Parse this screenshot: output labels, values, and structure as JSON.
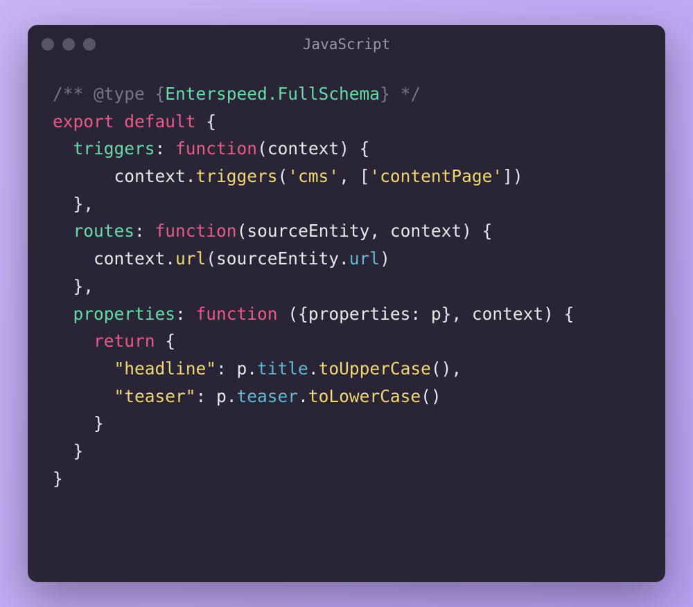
{
  "window": {
    "title": "JavaScript"
  },
  "code": {
    "tokens": [
      [
        {
          "t": "/** ",
          "c": "c-comment"
        },
        {
          "t": "@type",
          "c": "c-comment"
        },
        {
          "t": " {",
          "c": "c-comment"
        },
        {
          "t": "Enterspeed.FullSchema",
          "c": "c-type"
        },
        {
          "t": "} */",
          "c": "c-comment"
        }
      ],
      [
        {
          "t": "export",
          "c": "c-keyword"
        },
        {
          "t": " ",
          "c": "c-default"
        },
        {
          "t": "default",
          "c": "c-keyword"
        },
        {
          "t": " {",
          "c": "c-default"
        }
      ],
      [
        {
          "t": "  ",
          "c": "c-default"
        },
        {
          "t": "triggers",
          "c": "c-key"
        },
        {
          "t": ": ",
          "c": "c-default"
        },
        {
          "t": "function",
          "c": "c-keyword"
        },
        {
          "t": "(",
          "c": "c-default"
        },
        {
          "t": "context",
          "c": "c-default"
        },
        {
          "t": ") {",
          "c": "c-default"
        }
      ],
      [
        {
          "t": "      context.",
          "c": "c-default"
        },
        {
          "t": "triggers",
          "c": "c-func"
        },
        {
          "t": "(",
          "c": "c-default"
        },
        {
          "t": "'cms'",
          "c": "c-string"
        },
        {
          "t": ", [",
          "c": "c-default"
        },
        {
          "t": "'contentPage'",
          "c": "c-string"
        },
        {
          "t": "])",
          "c": "c-default"
        }
      ],
      [
        {
          "t": "  },",
          "c": "c-default"
        }
      ],
      [
        {
          "t": "  ",
          "c": "c-default"
        },
        {
          "t": "routes",
          "c": "c-key"
        },
        {
          "t": ": ",
          "c": "c-default"
        },
        {
          "t": "function",
          "c": "c-keyword"
        },
        {
          "t": "(",
          "c": "c-default"
        },
        {
          "t": "sourceEntity",
          "c": "c-default"
        },
        {
          "t": ", ",
          "c": "c-default"
        },
        {
          "t": "context",
          "c": "c-default"
        },
        {
          "t": ") {",
          "c": "c-default"
        }
      ],
      [
        {
          "t": "    context.",
          "c": "c-default"
        },
        {
          "t": "url",
          "c": "c-func"
        },
        {
          "t": "(sourceEntity.",
          "c": "c-default"
        },
        {
          "t": "url",
          "c": "c-prop"
        },
        {
          "t": ")",
          "c": "c-default"
        }
      ],
      [
        {
          "t": "  },",
          "c": "c-default"
        }
      ],
      [
        {
          "t": "  ",
          "c": "c-default"
        },
        {
          "t": "properties",
          "c": "c-key"
        },
        {
          "t": ": ",
          "c": "c-default"
        },
        {
          "t": "function",
          "c": "c-keyword"
        },
        {
          "t": " ({",
          "c": "c-default"
        },
        {
          "t": "properties",
          "c": "c-default"
        },
        {
          "t": ": ",
          "c": "c-default"
        },
        {
          "t": "p",
          "c": "c-default"
        },
        {
          "t": "}, ",
          "c": "c-default"
        },
        {
          "t": "context",
          "c": "c-default"
        },
        {
          "t": ") {",
          "c": "c-default"
        }
      ],
      [
        {
          "t": "    ",
          "c": "c-default"
        },
        {
          "t": "return",
          "c": "c-return"
        },
        {
          "t": " {",
          "c": "c-default"
        }
      ],
      [
        {
          "t": "      ",
          "c": "c-default"
        },
        {
          "t": "\"headline\"",
          "c": "c-string"
        },
        {
          "t": ": p.",
          "c": "c-default"
        },
        {
          "t": "title",
          "c": "c-prop"
        },
        {
          "t": ".",
          "c": "c-default"
        },
        {
          "t": "toUpperCase",
          "c": "c-func"
        },
        {
          "t": "(),",
          "c": "c-default"
        }
      ],
      [
        {
          "t": "      ",
          "c": "c-default"
        },
        {
          "t": "\"teaser\"",
          "c": "c-string"
        },
        {
          "t": ": p.",
          "c": "c-default"
        },
        {
          "t": "teaser",
          "c": "c-prop"
        },
        {
          "t": ".",
          "c": "c-default"
        },
        {
          "t": "toLowerCase",
          "c": "c-func"
        },
        {
          "t": "()",
          "c": "c-default"
        }
      ],
      [
        {
          "t": "    }",
          "c": "c-default"
        }
      ],
      [
        {
          "t": "  }",
          "c": "c-default"
        }
      ],
      [
        {
          "t": "}",
          "c": "c-default"
        }
      ]
    ]
  }
}
